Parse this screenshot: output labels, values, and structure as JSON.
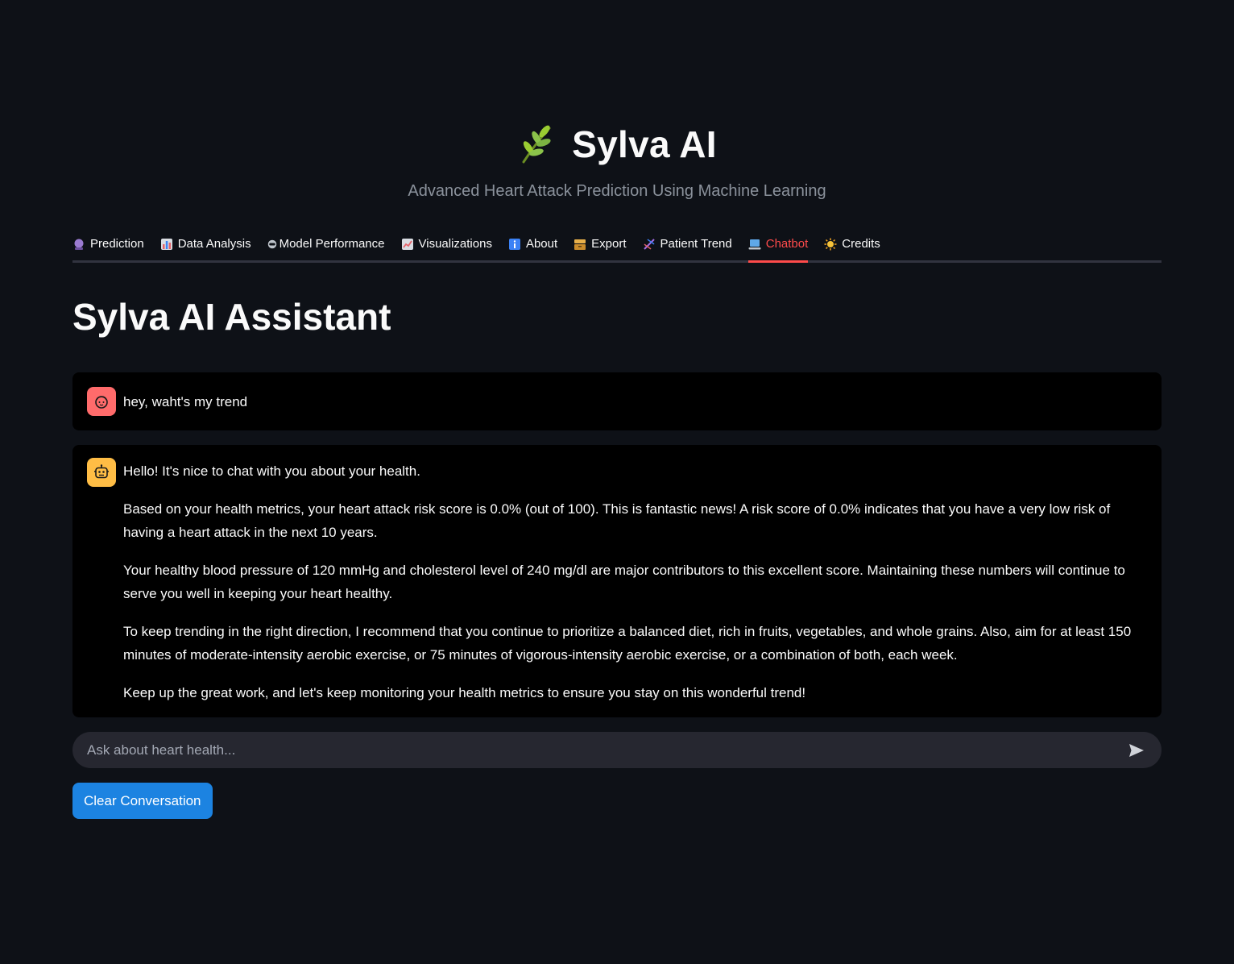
{
  "header": {
    "title": "Sylva AI",
    "subtitle": "Advanced Heart Attack Prediction Using Machine Learning",
    "logo_icon": "leaf-icon"
  },
  "tabs": [
    {
      "label": "Prediction",
      "icon": "crystal-ball-icon",
      "color": "#9b7bd1",
      "active": false
    },
    {
      "label": "Data Analysis",
      "icon": "bar-chart-icon",
      "color": "#e5646b",
      "active": false
    },
    {
      "label": "Model Performance",
      "icon": "robot-face-icon",
      "color": "#bfc5cc",
      "active": false
    },
    {
      "label": "Visualizations",
      "icon": "line-chart-icon",
      "color": "#d9dde3",
      "active": false
    },
    {
      "label": "About",
      "icon": "info-icon",
      "color": "#3b82f6",
      "active": false
    },
    {
      "label": "Export",
      "icon": "card-file-box-icon",
      "color": "#e8b04a",
      "active": false
    },
    {
      "label": "Patient Trend",
      "icon": "dna-icon",
      "color": "#a66ee6",
      "active": false
    },
    {
      "label": "Chatbot",
      "icon": "laptop-icon",
      "color": "#5fa8e8",
      "active": true
    },
    {
      "label": "Credits",
      "icon": "sun-icon",
      "color": "#f6c33a",
      "active": false
    }
  ],
  "page": {
    "title": "Sylva AI Assistant"
  },
  "chat": {
    "messages": [
      {
        "role": "user",
        "avatar_icon": "user-face-icon",
        "text": "hey, waht's my trend"
      },
      {
        "role": "assistant",
        "avatar_icon": "robot-icon",
        "paragraphs": [
          "Hello! It's nice to chat with you about your health.",
          "Based on your health metrics, your heart attack risk score is 0.0% (out of 100). This is fantastic news! A risk score of 0.0% indicates that you have a very low risk of having a heart attack in the next 10 years.",
          "Your healthy blood pressure of 120 mmHg and cholesterol level of 240 mg/dl are major contributors to this excellent score. Maintaining these numbers will continue to serve you well in keeping your heart healthy.",
          "To keep trending in the right direction, I recommend that you continue to prioritize a balanced diet, rich in fruits, vegetables, and whole grains. Also, aim for at least 150 minutes of moderate-intensity aerobic exercise, or 75 minutes of vigorous-intensity aerobic exercise, or a combination of both, each week.",
          "Keep up the great work, and let's keep monitoring your health metrics to ensure you stay on this wonderful trend!"
        ]
      }
    ],
    "input": {
      "value": "",
      "placeholder": "Ask about heart health...",
      "send_icon": "send-icon"
    }
  },
  "actions": {
    "clear_label": "Clear Conversation"
  },
  "colors": {
    "background": "#0e1117",
    "accent_active_tab": "#ff4b4b",
    "button_primary": "#1c83e1",
    "message_bg": "#000000",
    "input_bg": "#262730",
    "user_avatar": "#ff6b6b",
    "bot_avatar": "#ffbd45"
  }
}
